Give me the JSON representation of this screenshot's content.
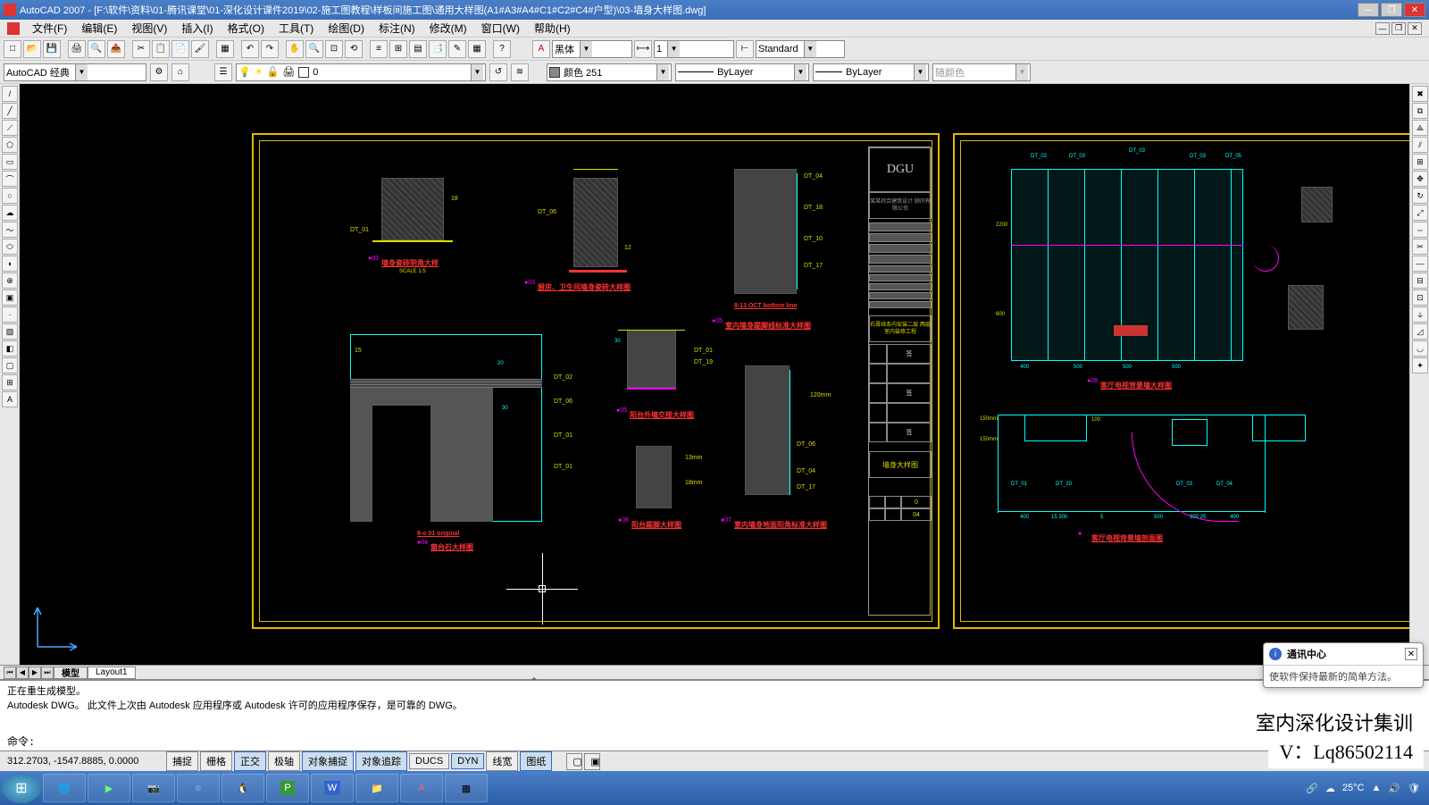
{
  "app": {
    "name": "AutoCAD 2007",
    "filepath": "[F:\\软件\\资料\\01-腾讯课堂\\01-深化设计课件2019\\02-施工图教程\\样板间施工图\\通用大样图(A1#A3#A4#C1#C2#C4#户型)\\03-墙身大样图.dwg]"
  },
  "menu": {
    "file": "文件(F)",
    "edit": "编辑(E)",
    "view": "视图(V)",
    "insert": "插入(I)",
    "format": "格式(O)",
    "tools": "工具(T)",
    "draw": "绘图(D)",
    "dimension": "标注(N)",
    "modify": "修改(M)",
    "window": "窗口(W)",
    "help": "帮助(H)"
  },
  "tb2": {
    "workspace": "AutoCAD 经典",
    "layer": "0",
    "color": "颜色 251",
    "linetype": "ByLayer",
    "lineweight": "ByLayer",
    "plotstyle": "随颜色",
    "textstyle_label": "黑体",
    "dimstyle_label": "Standard",
    "dimscale": "1"
  },
  "layout": {
    "model": "模型",
    "layout1": "Layout1"
  },
  "cmd": {
    "line1": "正在重生成模型。",
    "line2": "Autodesk DWG。  此文件上次由 Autodesk 应用程序或 Autodesk 许可的应用程序保存，是可靠的 DWG。",
    "prompt": "命令:"
  },
  "status": {
    "coords": "312.2703, -1547.8885, 0.0000",
    "snap": "捕捉",
    "grid": "栅格",
    "ortho": "正交",
    "polar": "极轴",
    "osnap": "对象捕捉",
    "otrack": "对象追踪",
    "ducs": "DUCS",
    "dyn": "DYN",
    "lwt": "线宽",
    "paper": "图纸"
  },
  "comm": {
    "title": "通讯中心",
    "body": "使软件保持最新的简单方法。"
  },
  "overlay": {
    "l1": "室内深化设计集训",
    "l2": "V：Lq86502114"
  },
  "tray": {
    "temp": "25°C",
    "time_hidden": ""
  },
  "drawing": {
    "d1": "墙身瓷砖阴角大样",
    "d2": "厨房、卫生间墙身瓷砖大样图",
    "d3": "室内墙身踢脚线标准大样图",
    "d4": "窗台石大样图",
    "d5": "阳台外墙交接大样图",
    "d6": "阳台踢脚大样图",
    "d7": "室内墙身地面阳角标准大样图",
    "d8": "客厅电视背景墙大样图",
    "d9": "客厅电视背景墙剖面图",
    "tb1": "石膏线条内安装二层 两层室内装修工程",
    "tb2": "墙身大样图",
    "logo": "DGU",
    "company": "某某综合建筑设计 顾问有限公司",
    "scale": "SCALE 1:5"
  }
}
